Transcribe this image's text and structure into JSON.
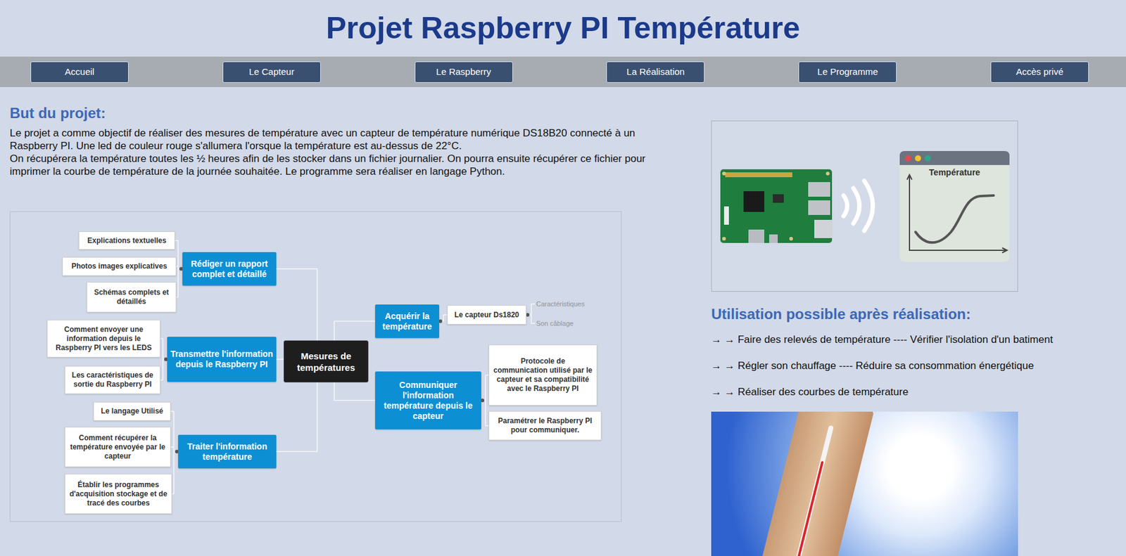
{
  "page": {
    "title": "Projet Raspberry PI Température"
  },
  "nav": [
    "Accueil",
    "Le Capteur",
    "Le Raspberry",
    "La Réalisation",
    "Le Programme",
    "Accès privé"
  ],
  "intro": {
    "heading": "But du projet:",
    "paragraphs": [
      "Le projet a comme objectif de réaliser des mesures de température avec un capteur de température numérique DS18B20 connecté à un Raspberry PI. Une led de couleur rouge s'allumera l'orsque la température est au-dessus de 22°C.",
      "On récupérera la température toutes les ½ heures afin de les stocker dans un fichier journalier. On pourra ensuite récupérer ce fichier pour imprimer la courbe de température de la journée souhaitée. Le programme sera réaliser en langage Python."
    ]
  },
  "mindmap": {
    "root": "Mesures de températures",
    "left": [
      {
        "label": "Rédiger un rapport complet et détaillé",
        "children": [
          "Explications textuelles",
          "Photos images explicatives",
          "Schémas complets et détaillés"
        ]
      },
      {
        "label": "Transmettre l'information depuis le Raspberry PI",
        "children": [
          "Comment envoyer une information depuis le Raspberry PI vers les LEDS",
          "Les caractéristiques de sortie du Raspberry PI"
        ]
      },
      {
        "label": "Traiter l'information température",
        "children": [
          "Le langage Utilisé",
          "Comment récupérer la température envoyée par le capteur",
          "Établir les programmes d'acquisition stockage et de tracé des courbes"
        ]
      }
    ],
    "right": [
      {
        "label": "Acquérir la température",
        "children": [
          {
            "label": "Le capteur Ds1820",
            "children": [
              "Caractéristiques",
              "Son câblage"
            ]
          }
        ]
      },
      {
        "label": "Communiquer l'information température depuis le capteur",
        "children": [
          {
            "label": "Protocole de communication utilisé par le capteur et sa compatibilité avec le Raspberry PI",
            "children": []
          },
          {
            "label": "Paramétrer le Raspberry PI pour communiquer.",
            "children": []
          }
        ]
      }
    ]
  },
  "illustration": {
    "window_title": "Température"
  },
  "usage": {
    "heading": "Utilisation possible après réalisation:",
    "items": [
      "→ → Faire des relevés de température ---- Vérifier l'isolation d'un batiment",
      "→ → Régler son chauffage ---- Réduire sa consommation énergétique",
      "→ → Réaliser des courbes de température"
    ]
  }
}
